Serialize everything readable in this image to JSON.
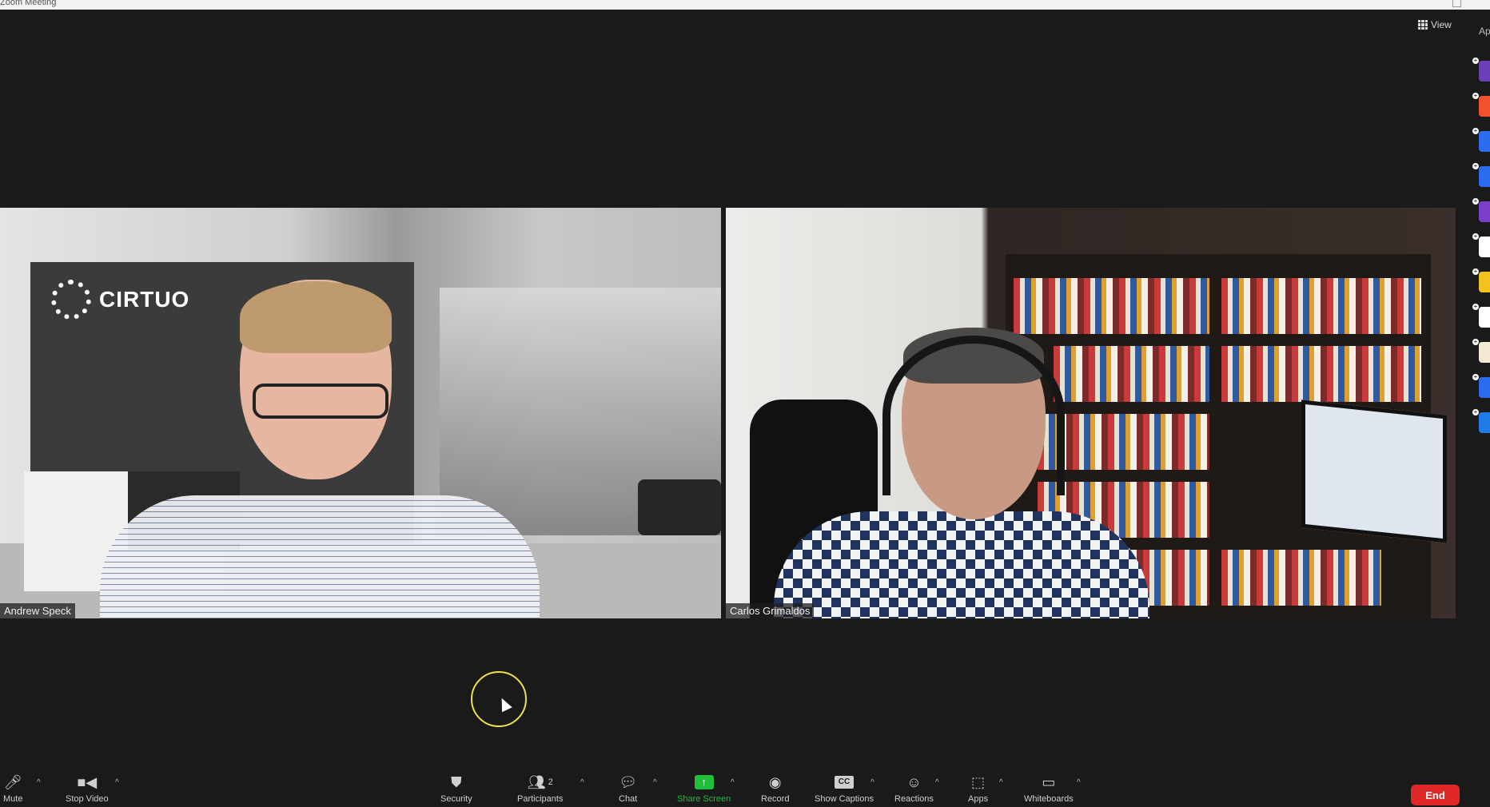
{
  "window": {
    "title": "Zoom Meeting"
  },
  "header": {
    "view_label": "View",
    "apps_label": "Ap"
  },
  "participants": [
    {
      "name": "Andrew Speck"
    },
    {
      "name": "Carlos Grimaldos"
    }
  ],
  "background": {
    "logo_text": "CIRTUO"
  },
  "toolbar": {
    "mute": "Mute",
    "stop_video": "Stop Video",
    "security": "Security",
    "participants": "Participants",
    "participants_count": "2",
    "chat": "Chat",
    "share_screen": "Share Screen",
    "record": "Record",
    "show_captions": "Show Captions",
    "captions_icon": "CC",
    "reactions": "Reactions",
    "apps": "Apps",
    "whiteboards": "Whiteboards",
    "end": "End"
  },
  "icons": {
    "mic": "microphone-icon",
    "video": "video-camera-icon",
    "security": "shield-icon",
    "participants": "people-icon",
    "chat": "chat-bubble-icon",
    "share": "share-arrow-icon",
    "record": "record-icon",
    "captions": "cc-icon",
    "reactions": "emoji-icon",
    "apps": "apps-icon",
    "whiteboards": "whiteboard-icon",
    "view": "grid-icon"
  },
  "colors": {
    "background": "#1a1a1a",
    "share_green": "#1fbf3a",
    "end_red": "#e02828",
    "cursor_ring": "#f0e24b"
  },
  "app_rail": [
    {
      "color": "#6b3fb8"
    },
    {
      "color": "#f0532b"
    },
    {
      "color": "#2d6cf0"
    },
    {
      "color": "#2d6cf0"
    },
    {
      "color": "#7a3fc8"
    },
    {
      "color": "#ffffff"
    },
    {
      "color": "#f4c21c"
    },
    {
      "color": "#ffffff"
    },
    {
      "color": "#f4e9d2"
    },
    {
      "color": "#2d6cf0"
    },
    {
      "color": "#1e7be6"
    }
  ]
}
